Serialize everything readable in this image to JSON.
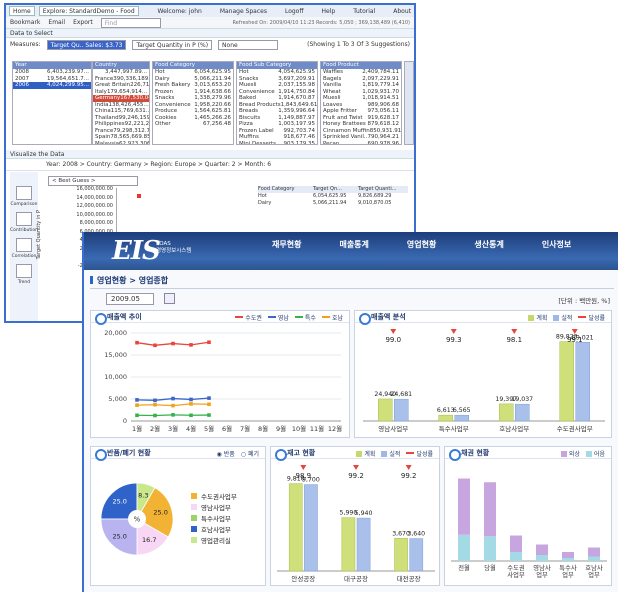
{
  "back_window": {
    "tabs": [
      "Home",
      "Explore: StandardDemo - Food"
    ],
    "top_links": [
      "Welcome: john",
      "Manage Spaces",
      "Logoff",
      "Help",
      "Tutorial",
      "About"
    ],
    "toolbar": [
      "Bookmark",
      "Email",
      "Export",
      "Find"
    ],
    "toolbar_status": "Refreshed On: 2009/04/10 11:23 Records: 5,050 ; 369,138,489 (6,410)",
    "section_title": "Data to Select",
    "measures_label": "Measures:",
    "measure_selected": "Target Qu.. Sales: $3.73",
    "measure_second": "Target Quantity in P (%)",
    "measure_third": "None",
    "showing": "(Showing 1 To 3 Of 3 Suggestions)",
    "year_pane": {
      "header": "Year",
      "rows": [
        {
          "k": "2008",
          "v": "6,403,239.97..."
        },
        {
          "k": "2007",
          "v": "19,564,651.7..."
        },
        {
          "k": "2006",
          "v": "4,024,299.95..."
        }
      ]
    },
    "country_pane": {
      "header": "Country",
      "rows": [
        {
          "k": "",
          "v": "3,447,997.89..."
        },
        {
          "k": "France",
          "v": "390,336,189..."
        },
        {
          "k": "Great Britain",
          "v": "226,712,913..."
        },
        {
          "k": "Italy",
          "v": "179,654,914..."
        },
        {
          "k": "Germany",
          "v": "167,530,048..."
        },
        {
          "k": "India",
          "v": "138,426,455..."
        },
        {
          "k": "China",
          "v": "115,769,631..."
        },
        {
          "k": "Thailand",
          "v": "99,246,159.56"
        },
        {
          "k": "Philippines",
          "v": "92,221,297.05"
        },
        {
          "k": "France",
          "v": "79,298,312.76"
        },
        {
          "k": "Spain",
          "v": "78,565,669.85"
        },
        {
          "k": "Malaysia",
          "v": "62,923,306.66"
        },
        {
          "k": "Advanced...",
          "v": ""
        }
      ]
    },
    "food_cat_pane": {
      "header": "Food Category",
      "rows": [
        {
          "k": "Hot",
          "v": "6,054,625.95"
        },
        {
          "k": "Dairy",
          "v": "5,066,211.94"
        },
        {
          "k": "Fresh Bakery",
          "v": "3,013,653.20"
        },
        {
          "k": "Frozen",
          "v": "1,914,638.66"
        },
        {
          "k": "Snacks",
          "v": "1,338,279.96"
        },
        {
          "k": "Convenience",
          "v": "1,958,220.66"
        },
        {
          "k": "Produce",
          "v": "1,564,625.81"
        },
        {
          "k": "Cookies",
          "v": "1,465,266.26"
        },
        {
          "k": "Other",
          "v": "67,256.48"
        }
      ]
    },
    "food_sub_pane": {
      "header": "Food Sub Category",
      "rows": [
        {
          "k": "Hot",
          "v": "4,054,625.95"
        },
        {
          "k": "Snacks",
          "v": "3,697,209.91"
        },
        {
          "k": "Muesli",
          "v": "2,037,155.98"
        },
        {
          "k": "Convenience",
          "v": "1,914,750.84"
        },
        {
          "k": "Baked",
          "v": "1,914,670.87"
        },
        {
          "k": "Bread Products",
          "v": "1,843,649.61"
        },
        {
          "k": "Breads",
          "v": "1,359,996.64"
        },
        {
          "k": "Biscuits",
          "v": "1,149,887.97"
        },
        {
          "k": "Pizza",
          "v": "1,003,197.95"
        },
        {
          "k": "Frozen Label",
          "v": "992,703.74"
        },
        {
          "k": "Muffins",
          "v": "918,677.46"
        },
        {
          "k": "Mini Desserts",
          "v": "903,179.35"
        },
        {
          "k": "Topping",
          "v": "795,069.67"
        },
        {
          "k": "Advanced...",
          "v": ""
        }
      ]
    },
    "food_product_pane": {
      "header": "Food Product",
      "rows": [
        {
          "k": "Waffles",
          "v": "2,409,784.11"
        },
        {
          "k": "Bagels",
          "v": "2,097,229.91"
        },
        {
          "k": "Vanilla",
          "v": "1,819,779.14"
        },
        {
          "k": "Wheat",
          "v": "1,029,931.70"
        },
        {
          "k": "Muesli",
          "v": "1,018,914.51"
        },
        {
          "k": "Loaves",
          "v": "989,906.68"
        },
        {
          "k": "Apple Fritter",
          "v": "973,056.11"
        },
        {
          "k": "Fruit and Twist",
          "v": "919,628.17"
        },
        {
          "k": "Honey Brattees",
          "v": "879,618.12"
        },
        {
          "k": "Cinnamon Muffin",
          "v": "850,931.91"
        },
        {
          "k": "Sprinkled Vanil..",
          "v": "790,964.21"
        },
        {
          "k": "Pecan",
          "v": "690,978.96"
        },
        {
          "k": "Peanut Bar",
          "v": "690,664.14"
        },
        {
          "k": "Advanced...",
          "v": ""
        }
      ]
    },
    "viz_title": "Visualize the Data",
    "viz_path": "Year: 2008 > Country: Germany > Region: Europe > Quarter: 2 > Month: 6",
    "viz_select": "< Best Guess >",
    "side_labels": [
      "Comparison",
      "Contribution",
      "Correlation",
      "Trend"
    ],
    "y_axis_label": "Target Quantity in P",
    "y_ticks": [
      "16,000,000.00",
      "14,000,000.00",
      "12,000,000.00",
      "10,000,000.00",
      "8,000,000.00",
      "6,000,000.00",
      "4,000,000.00",
      "2,000,000.00",
      "0",
      "-2,000,000.00",
      "-4,..."
    ],
    "mini_table": {
      "headers": [
        "Food Category",
        "Target Qn...",
        "Target Quanti..."
      ],
      "rows": [
        [
          "Hot",
          "6,054,625.95",
          "9,826,689.29"
        ],
        [
          "Dairy",
          "5,066,211.94",
          "9,010,870.05"
        ]
      ]
    }
  },
  "front_window": {
    "logo": "EIS",
    "logo_sub_1": "KOAS",
    "logo_sub_2": "경영정보시스템",
    "nav": [
      "재무현황",
      "매출통계",
      "영업현황",
      "생산통계",
      "인사정보"
    ],
    "breadcrumb": "영업현황 > 영업종합",
    "date": "2009.05",
    "unit": "[단위 : 백만원, %]",
    "sales_trend": {
      "title": "매출액 추이",
      "legend": [
        "수도권",
        "영남",
        "특수",
        "호남"
      ],
      "colors": [
        "#e8453c",
        "#3a67c9",
        "#37b24d",
        "#f2a01f"
      ],
      "y_ticks": [
        "20,000",
        "15,000",
        "10,000",
        "5,000",
        "0"
      ],
      "x_ticks": [
        "1월",
        "2월",
        "3월",
        "4월",
        "5월",
        "6월",
        "7월",
        "8월",
        "9월",
        "10월",
        "11월",
        "12월"
      ]
    },
    "sales_analysis": {
      "title": "매출액 분석",
      "legend": [
        "계획",
        "실적",
        "달성률"
      ],
      "rates": [
        "99.0",
        "99.3",
        "98.1",
        "99.1"
      ],
      "bar_labels": [
        [
          "24,940",
          "24,681"
        ],
        [
          "6,613",
          "6,565"
        ],
        [
          "19,397",
          "19,037"
        ],
        [
          "89,823",
          "89,021"
        ]
      ],
      "categories": [
        "영남사업부",
        "특수사업부",
        "호남사업부",
        "수도권사업부"
      ]
    },
    "returns": {
      "title": "반품/폐기 현황",
      "options": [
        "반품",
        "폐기"
      ],
      "slice_labels": [
        "25.0",
        "8.3",
        "25.0",
        "16.7",
        "25.0"
      ],
      "center": "%",
      "legend": [
        "수도권사업부",
        "영남사업부",
        "특수사업부",
        "호남사업부",
        "영업관리실"
      ]
    },
    "inventory": {
      "title": "재고 현황",
      "legend": [
        "계획",
        "실적",
        "달성률"
      ],
      "rates": [
        "98.9",
        "99.2",
        "99.2"
      ],
      "bar_labels": [
        [
          "9,810",
          "9,700"
        ],
        [
          "5,990",
          "5,940"
        ],
        [
          "3,670",
          "3,640"
        ]
      ],
      "categories": [
        "안성공장",
        "대구공장",
        "대전공장"
      ]
    },
    "receivables": {
      "title": "채권 현황",
      "legend": [
        "외상",
        "어음"
      ],
      "categories": [
        "전월",
        "당월",
        "수도권\n사업부",
        "영남사\n업부",
        "특수사\n업부",
        "호남사\n업부"
      ]
    }
  },
  "chart_data": [
    {
      "type": "line",
      "title": "매출액 추이",
      "categories": [
        "1월",
        "2월",
        "3월",
        "4월",
        "5월",
        "6월",
        "7월",
        "8월",
        "9월",
        "10월",
        "11월",
        "12월"
      ],
      "ylim": [
        0,
        20000
      ],
      "series": [
        {
          "name": "수도권",
          "values": [
            17800,
            17200,
            17600,
            17300,
            17900,
            null,
            null,
            null,
            null,
            null,
            null,
            null
          ]
        },
        {
          "name": "영남",
          "values": [
            4800,
            4700,
            5100,
            4900,
            5200,
            null,
            null,
            null,
            null,
            null,
            null,
            null
          ]
        },
        {
          "name": "특수",
          "values": [
            1300,
            1250,
            1400,
            1300,
            1350,
            null,
            null,
            null,
            null,
            null,
            null,
            null
          ]
        },
        {
          "name": "호남",
          "values": [
            3600,
            3700,
            3500,
            3900,
            3800,
            null,
            null,
            null,
            null,
            null,
            null,
            null
          ]
        }
      ]
    },
    {
      "type": "bar",
      "title": "매출액 분석",
      "categories": [
        "영남사업부",
        "특수사업부",
        "호남사업부",
        "수도권사업부"
      ],
      "series": [
        {
          "name": "계획",
          "values": [
            24940,
            6613,
            19397,
            89823
          ]
        },
        {
          "name": "실적",
          "values": [
            24681,
            6565,
            19037,
            89021
          ]
        },
        {
          "name": "달성률",
          "values": [
            99.0,
            99.3,
            98.1,
            99.1
          ]
        }
      ],
      "ylim": [
        0,
        95000
      ]
    },
    {
      "type": "pie",
      "title": "반품/폐기 현황",
      "categories": [
        "수도권사업부",
        "영남사업부",
        "특수사업부",
        "호남사업부",
        "영업관리실"
      ],
      "values": [
        25.0,
        25.0,
        16.7,
        25.0,
        8.3
      ],
      "colors": [
        "#f2b233",
        "#f7d7f4",
        "#9bd36a",
        "#2f63c9",
        "#c9e88a"
      ]
    },
    {
      "type": "bar",
      "title": "재고 현황",
      "categories": [
        "안성공장",
        "대구공장",
        "대전공장"
      ],
      "series": [
        {
          "name": "계획",
          "values": [
            9810,
            5990,
            3670
          ]
        },
        {
          "name": "실적",
          "values": [
            9700,
            5940,
            3640
          ]
        },
        {
          "name": "달성률",
          "values": [
            98.9,
            99.2,
            99.2
          ]
        }
      ],
      "ylim": [
        0,
        11000
      ]
    },
    {
      "type": "bar",
      "title": "채권 현황",
      "categories": [
        "전월",
        "당월",
        "수도권사업부",
        "영남사업부",
        "특수사업부",
        "호남사업부"
      ],
      "series": [
        {
          "name": "외상",
          "values": [
            75,
            72,
            22,
            14,
            8,
            12
          ]
        },
        {
          "name": "어음",
          "values": [
            35,
            33,
            12,
            8,
            4,
            6
          ]
        }
      ],
      "ylim": [
        0,
        120
      ]
    }
  ]
}
